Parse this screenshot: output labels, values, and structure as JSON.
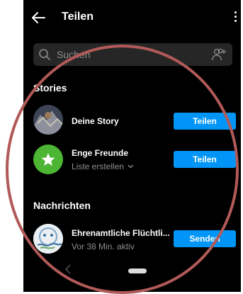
{
  "header": {
    "title": "Teilen"
  },
  "search": {
    "placeholder": "Suchen"
  },
  "stories": {
    "heading": "Stories",
    "items": [
      {
        "name": "Deine Story",
        "button": "Teilen"
      },
      {
        "name": "Enge Freunde",
        "subtitle": "Liste erstellen",
        "button": "Teilen"
      }
    ]
  },
  "messages": {
    "heading": "Nachrichten",
    "items": [
      {
        "name": "Ehrenamtliche Flüchtli...",
        "subtitle": "Vor 38 Min. aktiv",
        "button": "Senden"
      }
    ]
  },
  "colors": {
    "accent": "#0095f6",
    "close_friends": "#4cb533",
    "annotation_ring": "#b15a58"
  },
  "icons": {
    "back": "arrow-left-icon",
    "more": "more-vertical-icon",
    "search": "search-icon",
    "new_group": "add-people-icon",
    "close_friends": "star-icon",
    "chevron": "chevron-down-icon"
  }
}
